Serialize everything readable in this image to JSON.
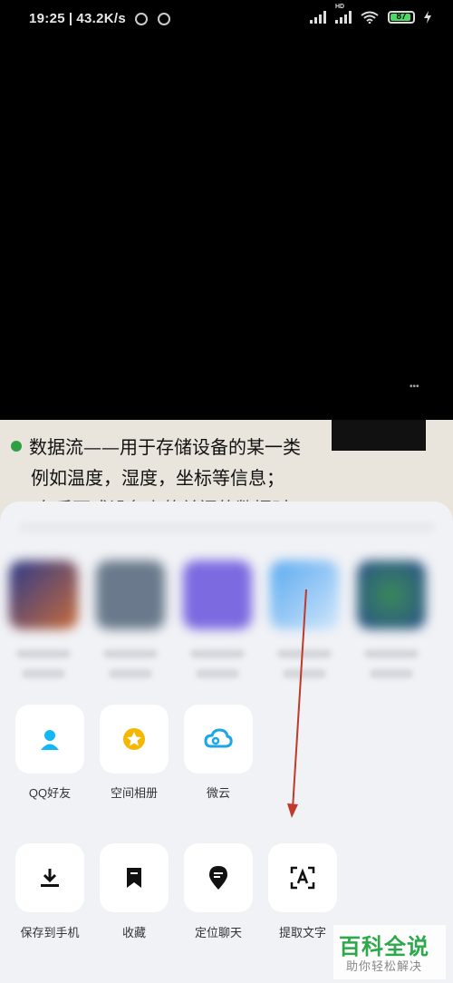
{
  "status_bar": {
    "time": "19:25",
    "speed": "43.2K/s",
    "battery_level": "87",
    "network_badge": "HD"
  },
  "document": {
    "line1": "数据流——用于存储设备的某一类",
    "line2": "例如温度，湿度，坐标等信息；",
    "line3": "—在后面式设备上的关闭的数据时"
  },
  "share_row_1": [
    {
      "label": "QQ好友",
      "icon": "qq-friend-icon",
      "color": "#12b7f5"
    },
    {
      "label": "空间相册",
      "icon": "qzone-album-icon",
      "color": "#f5b800"
    },
    {
      "label": "微云",
      "icon": "weiyun-cloud-icon",
      "color": "#1aa7e8"
    }
  ],
  "share_row_2": [
    {
      "label": "保存到手机",
      "icon": "download-icon"
    },
    {
      "label": "收藏",
      "icon": "bookmark-icon"
    },
    {
      "label": "定位聊天",
      "icon": "locate-chat-icon"
    },
    {
      "label": "提取文字",
      "icon": "extract-text-icon"
    }
  ],
  "watermark": {
    "title": "百科全说",
    "subtitle": "助你轻松解决"
  },
  "colors": {
    "annotation_arrow": "#c0392b",
    "sheet_bg": "#f1f2f6"
  }
}
